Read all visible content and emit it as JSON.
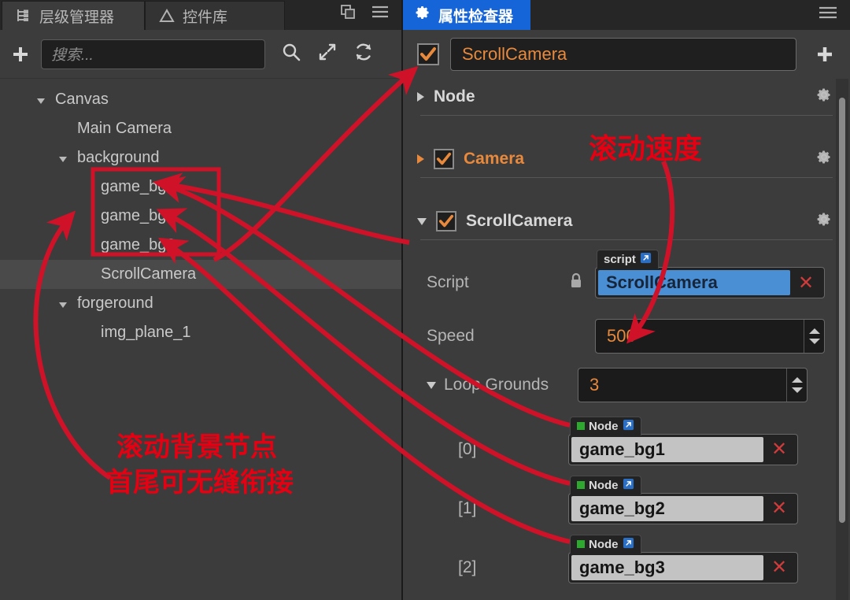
{
  "left_panel": {
    "tabs": [
      {
        "label": "层级管理器",
        "icon": "hierarchy-icon",
        "active": true
      },
      {
        "label": "控件库",
        "icon": "triangle-icon",
        "active": false
      }
    ],
    "tabbar_icons": [
      "copy-panel-icon",
      "hamburger-menu-icon"
    ],
    "toolbar": {
      "add_label": "+",
      "search_placeholder": "搜索...",
      "icons": [
        "search-icon",
        "expand-icon",
        "refresh-icon"
      ]
    },
    "tree": [
      {
        "label": "Canvas",
        "depth": 0,
        "caret": "down",
        "selected": false
      },
      {
        "label": "Main Camera",
        "depth": 1,
        "caret": "none",
        "selected": false
      },
      {
        "label": "background",
        "depth": 1,
        "caret": "down",
        "selected": false
      },
      {
        "label": "game_bg1",
        "depth": 2,
        "caret": "none",
        "selected": false
      },
      {
        "label": "game_bg2",
        "depth": 2,
        "caret": "none",
        "selected": false
      },
      {
        "label": "game_bg3",
        "depth": 2,
        "caret": "none",
        "selected": false
      },
      {
        "label": "ScrollCamera",
        "depth": 2,
        "caret": "none",
        "selected": true
      },
      {
        "label": "forgeround",
        "depth": 1,
        "caret": "down",
        "selected": false
      },
      {
        "label": "img_plane_1",
        "depth": 2,
        "caret": "none",
        "selected": false
      }
    ]
  },
  "right_panel": {
    "tab": {
      "label": "属性检查器",
      "icon": "gear-icon"
    },
    "tabbar_icon": "hamburger-menu-icon",
    "header": {
      "enabled": true,
      "node_name": "ScrollCamera",
      "add_label": "+"
    },
    "sections": [
      {
        "name": "Node",
        "caret": "right",
        "has_checkbox": false,
        "title_color": "white",
        "gear": "gear-icon"
      },
      {
        "name": "Camera",
        "caret": "right",
        "has_checkbox": true,
        "checked": true,
        "title_color": "orange",
        "gear": "gear-icon"
      },
      {
        "name": "ScrollCamera",
        "caret": "down",
        "has_checkbox": true,
        "checked": true,
        "title_color": "white",
        "gear": "gear-icon"
      }
    ],
    "properties": {
      "script": {
        "label": "Script",
        "lock_icon": "lock-icon",
        "badge": "script",
        "badge_link_icon": "external-link-icon",
        "value": "ScrollCamera",
        "clear_icon": "close-x-icon"
      },
      "speed": {
        "label": "Speed",
        "value": "500"
      },
      "loop_grounds": {
        "label": "Loop Grounds",
        "caret": "down",
        "value": "3"
      },
      "array_items": [
        {
          "index": "[0]",
          "badge": "Node",
          "value": "game_bg1"
        },
        {
          "index": "[1]",
          "badge": "Node",
          "value": "game_bg2"
        },
        {
          "index": "[2]",
          "badge": "Node",
          "value": "game_bg3"
        }
      ]
    }
  },
  "annotations": {
    "scroll_speed": "滚动速度",
    "bg_nodes_line1": "滚动背景节点",
    "bg_nodes_line2": "首尾可无缝衔接",
    "color": "#e60012",
    "highlight_box": "game_bg1/game_bg2/game_bg3"
  },
  "colors": {
    "accent_orange": "#e8893c",
    "tab_active_blue": "#1565d8",
    "annotation_red": "#e60012",
    "panel_bg": "#3c3c3c",
    "tabbar_bg": "#262626",
    "ref_blue": "#4a8fd4",
    "node_green": "#2fa82f"
  }
}
